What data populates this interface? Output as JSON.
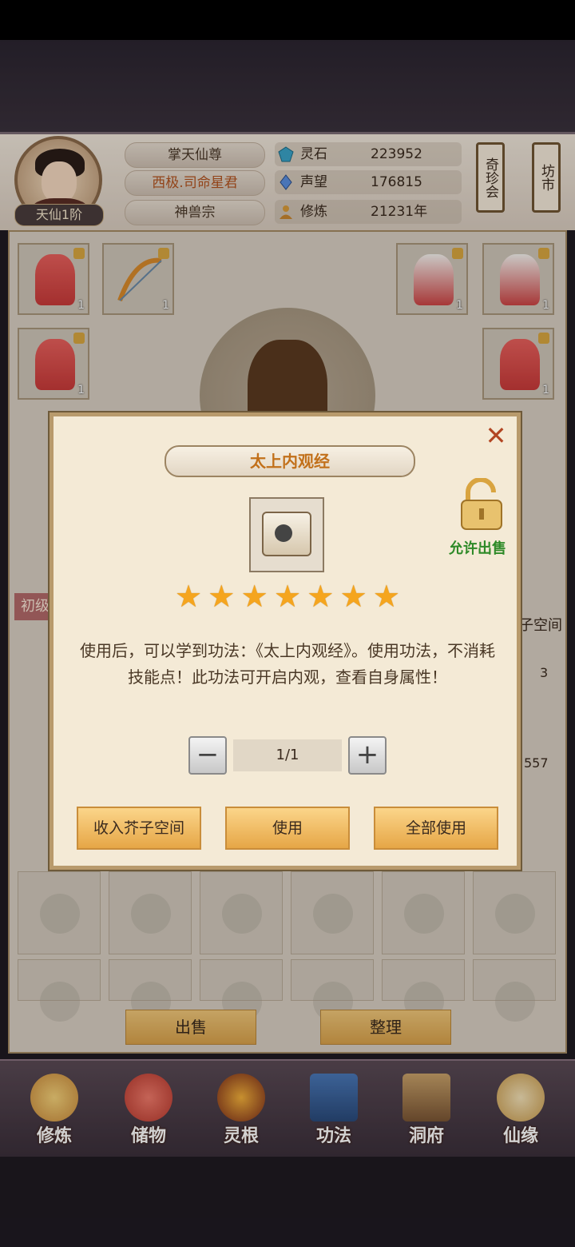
{
  "header": {
    "rank": "天仙1阶",
    "titles": [
      "掌天仙尊",
      "西极.司命星君",
      "神兽宗"
    ],
    "stats": [
      {
        "icon": "spirit-stone-icon",
        "label": "灵石",
        "value": "223952"
      },
      {
        "icon": "reputation-icon",
        "label": "声望",
        "value": "176815"
      },
      {
        "icon": "cultivation-icon",
        "label": "修炼",
        "value": "21231年"
      }
    ],
    "side_buttons": [
      "奇珍会",
      "坊市"
    ]
  },
  "inventory": {
    "tier_tag": "初级",
    "side_label": "子空间",
    "slot_counts": [
      "1",
      "1",
      "1",
      "1",
      "1",
      "1",
      "1",
      "1"
    ],
    "partial_counts": [
      "3",
      "557"
    ]
  },
  "bottom_buttons": {
    "sell": "出售",
    "sort": "整理"
  },
  "nav": [
    {
      "label": "修炼",
      "icon": "cultivate-icon"
    },
    {
      "label": "储物",
      "icon": "storage-bag-icon"
    },
    {
      "label": "灵根",
      "icon": "spirit-root-icon"
    },
    {
      "label": "功法",
      "icon": "skill-book-icon"
    },
    {
      "label": "洞府",
      "icon": "cave-abode-icon"
    },
    {
      "label": "仙缘",
      "icon": "immortal-fate-icon"
    }
  ],
  "dialog": {
    "item_name": "太上内观经",
    "allow_sale_label": "允许出售",
    "stars": 7,
    "description": "使用后，可以学到功法：《太上内观经》。使用功法，不消耗技能点！此功法可开启内观，查看自身属性！",
    "quantity": "1/1",
    "minus": "−",
    "plus": "+",
    "close": "✕",
    "buttons": {
      "store": "收入芥子空间",
      "use": "使用",
      "use_all": "全部使用"
    }
  }
}
